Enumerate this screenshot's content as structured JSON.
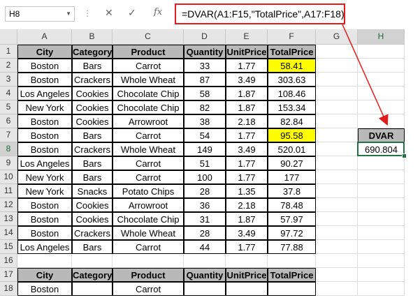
{
  "namebox": "H8",
  "formula_icons": {
    "cancel": "✕",
    "enter": "✓",
    "fx": "fx"
  },
  "formula": "=DVAR(A1:F15,\"TotalPrice\",A17:F18)",
  "columns": [
    "A",
    "B",
    "C",
    "D",
    "E",
    "F",
    "G",
    "H"
  ],
  "rows": [
    "1",
    "2",
    "3",
    "4",
    "5",
    "6",
    "7",
    "8",
    "9",
    "10",
    "11",
    "12",
    "13",
    "14",
    "15",
    "16",
    "17",
    "18"
  ],
  "table": {
    "headers": [
      "City",
      "Category",
      "Product",
      "Quantity",
      "UnitPrice",
      "TotalPrice"
    ],
    "data": [
      [
        "Boston",
        "Bars",
        "Carrot",
        "33",
        "1.77",
        "58.41"
      ],
      [
        "Boston",
        "Crackers",
        "Whole Wheat",
        "87",
        "3.49",
        "303.63"
      ],
      [
        "Los Angeles",
        "Cookies",
        "Chocolate Chip",
        "58",
        "1.87",
        "108.46"
      ],
      [
        "New York",
        "Cookies",
        "Chocolate Chip",
        "82",
        "1.87",
        "153.34"
      ],
      [
        "Boston",
        "Cookies",
        "Arrowroot",
        "38",
        "2.18",
        "82.84"
      ],
      [
        "Boston",
        "Bars",
        "Carrot",
        "54",
        "1.77",
        "95.58"
      ],
      [
        "Boston",
        "Crackers",
        "Whole Wheat",
        "149",
        "3.49",
        "520.01"
      ],
      [
        "Los Angeles",
        "Bars",
        "Carrot",
        "51",
        "1.77",
        "90.27"
      ],
      [
        "New York",
        "Bars",
        "Carrot",
        "100",
        "1.77",
        "177"
      ],
      [
        "New York",
        "Snacks",
        "Potato Chips",
        "28",
        "1.35",
        "37.8"
      ],
      [
        "Boston",
        "Cookies",
        "Arrowroot",
        "36",
        "2.18",
        "78.48"
      ],
      [
        "Boston",
        "Cookies",
        "Chocolate Chip",
        "31",
        "1.87",
        "57.97"
      ],
      [
        "Boston",
        "Crackers",
        "Whole Wheat",
        "28",
        "3.49",
        "97.72"
      ],
      [
        "Los Angeles",
        "Bars",
        "Carrot",
        "44",
        "1.77",
        "77.88"
      ]
    ],
    "highlight_color": "#ffff00"
  },
  "criteria": {
    "headers": [
      "City",
      "Category",
      "Product",
      "Quantity",
      "UnitPrice",
      "TotalPrice"
    ],
    "values": [
      "Boston",
      "",
      "Carrot",
      "",
      "",
      ""
    ]
  },
  "dvar": {
    "label": "DVAR",
    "value": "690.804"
  },
  "colors": {
    "arrow": "#e31b1b",
    "header_fill": "#b9b9b9",
    "selection": "#217346"
  }
}
